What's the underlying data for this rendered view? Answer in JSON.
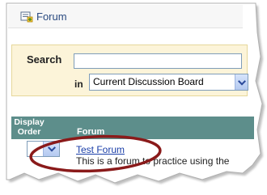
{
  "header": {
    "icon": "forum-icon",
    "label": "Forum"
  },
  "search": {
    "label": "Search",
    "input_value": "",
    "in_label": "in",
    "scope_selected": "Current Discussion Board"
  },
  "table": {
    "headers": {
      "order": "Display Order",
      "forum": "Forum"
    },
    "rows": [
      {
        "order_value": "",
        "title": "Test Forum",
        "description": "This is a forum to practice using the"
      }
    ]
  },
  "colors": {
    "header_bg": "#5d8e8b",
    "search_bg": "#fcf4d9",
    "link": "#1a3ea8",
    "highlight_ellipse": "#8a1a1a"
  }
}
